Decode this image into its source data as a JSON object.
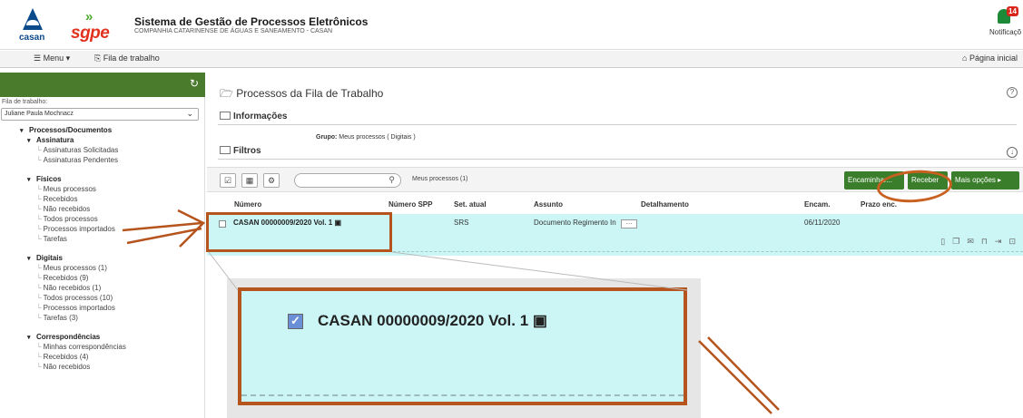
{
  "header": {
    "casan_logo_text": "casan",
    "sgpe_logo_text": "sgpe",
    "title": "Sistema de Gestão de Processos Eletrônicos",
    "subtitle": "COMPANHIA CATARINENSE DE ÁGUAS E SANEAMENTO - CASAN",
    "notification_count": "14",
    "notification_label": "Notificaçõ"
  },
  "menubar": {
    "menu_label": "Menu",
    "fila_label": "Fila de trabalho",
    "home_label": "Página inicial"
  },
  "sidebar": {
    "fila_label": "Fila de trabalho:",
    "fila_selected": "Juliane Paula Mochnacz",
    "root": "Processos/Documentos",
    "groups": [
      {
        "label": "Assinatura",
        "items": [
          "Assinaturas Solicitadas",
          "Assinaturas Pendentes"
        ]
      },
      {
        "label": "Físicos",
        "items": [
          "Meus processos",
          "Recebidos",
          "Não recebidos",
          "Todos processos",
          "Processos importados",
          "Tarefas"
        ]
      },
      {
        "label": "Digitais",
        "items": [
          "Meus processos (1)",
          "Recebidos (9)",
          "Não recebidos (1)",
          "Todos processos (10)",
          "Processos importados",
          "Tarefas (3)"
        ]
      },
      {
        "label": "Correspondências",
        "items": [
          "Minhas correspondências",
          "Recebidos (4)",
          "Não recebidos"
        ]
      }
    ]
  },
  "main": {
    "title": "Processos da Fila de Trabalho",
    "info_label": "Informações",
    "group_prefix": "Grupo:",
    "group_value": "Meus processos  ( Digitais )",
    "filters_label": "Filtros",
    "search_placeholder": "",
    "list_count": "Meus processos (1)",
    "buttons": {
      "encaminhar": "Encaminhar...",
      "receber": "Receber",
      "mais_opcoes": "Mais opções"
    },
    "columns": [
      "Número",
      "Número SPP",
      "Set. atual",
      "Assunto",
      "Detalhamento",
      "Encam.",
      "Prazo enc."
    ],
    "rows": [
      {
        "numero": "CASAN 00000009/2020 Vol. 1",
        "numero_spp": "",
        "set_atual": "SRS",
        "assunto": "Documento Regimento In",
        "detalhamento": "",
        "encam": "06/11/2020",
        "prazo_enc": ""
      }
    ]
  },
  "zoom": {
    "numero": "CASAN 00000009/2020 Vol. 1"
  },
  "colors": {
    "accent_green": "#3a7d2a",
    "row_highlight": "#ccf6f6",
    "annotation": "#b5541c"
  }
}
